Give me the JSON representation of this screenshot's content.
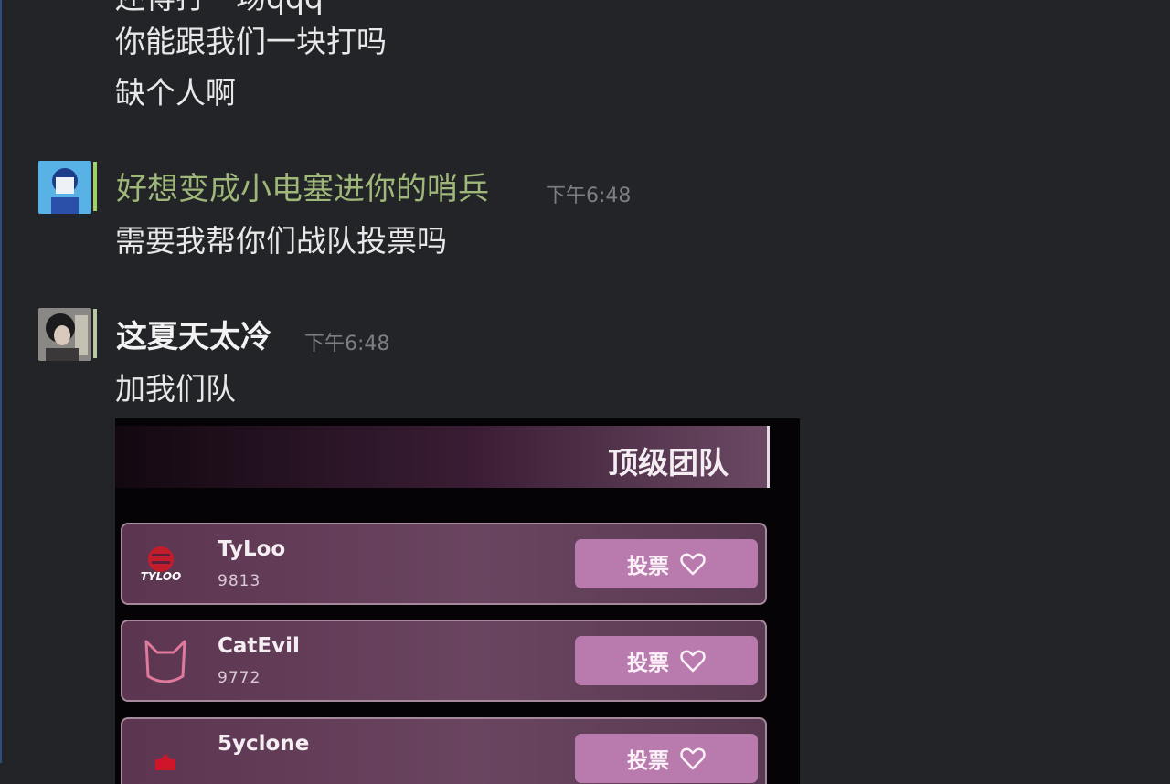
{
  "messages_prev": {
    "line0": "还得打一场qqq",
    "line1": "你能跟我们一块打吗",
    "line2": "缺个人啊"
  },
  "message1": {
    "username": "好想变成小电塞进你的哨兵",
    "timestamp": "下午6:48",
    "text": "需要我帮你们战队投票吗"
  },
  "message2": {
    "username": "这夏天太冷",
    "timestamp": "下午6:48",
    "text": "加我们队"
  },
  "embed": {
    "title": "顶级团队",
    "teams": [
      {
        "name": "TyLoo",
        "logo_text": "TYLOO",
        "votes": "9813",
        "vote_label": "投票"
      },
      {
        "name": "CatEvil",
        "votes": "9772",
        "vote_label": "投票"
      },
      {
        "name": "5yclone",
        "votes": "",
        "vote_label": "投票"
      }
    ]
  },
  "colors": {
    "background": "#222428",
    "username_green": "#9fb87a",
    "vote_button": "#b97aae",
    "card": "#6a4560"
  }
}
